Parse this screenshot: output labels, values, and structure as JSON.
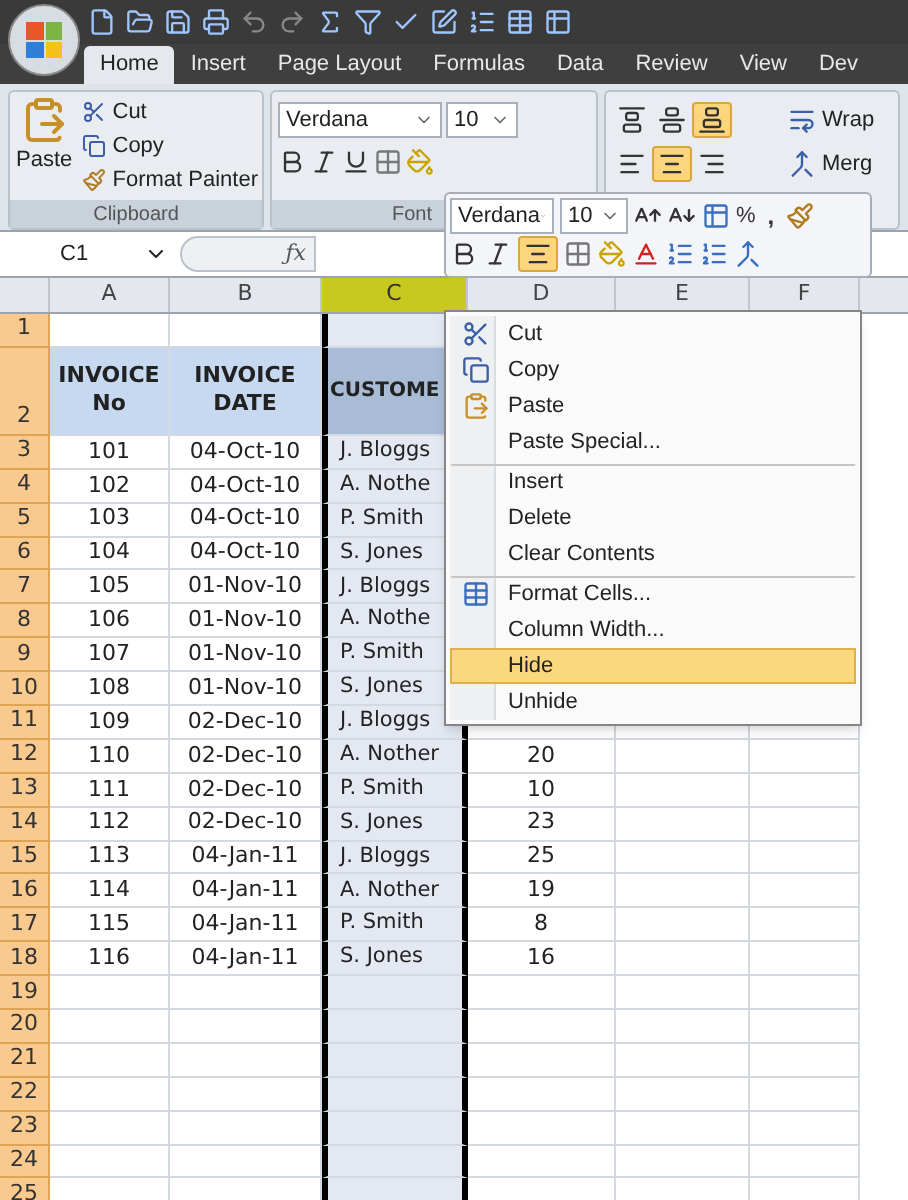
{
  "ribbon": {
    "tabs": [
      {
        "label": "Home",
        "selected": true
      },
      {
        "label": "Insert",
        "selected": false
      },
      {
        "label": "Page Layout",
        "selected": false
      },
      {
        "label": "Formulas",
        "selected": false
      },
      {
        "label": "Data",
        "selected": false
      },
      {
        "label": "Review",
        "selected": false
      },
      {
        "label": "View",
        "selected": false
      },
      {
        "label": "Dev",
        "selected": false
      }
    ],
    "clipboard": {
      "paste": "Paste",
      "cut": "Cut",
      "copy": "Copy",
      "format_painter": "Format Painter",
      "label": "Clipboard"
    },
    "font": {
      "name": "Verdana",
      "size": "10",
      "label": "Font"
    },
    "alignment": {
      "vertical": [
        {
          "selected": false
        },
        {
          "selected": false
        },
        {
          "selected": true
        }
      ],
      "horizontal": [
        {
          "selected": false
        },
        {
          "selected": true
        },
        {
          "selected": false
        }
      ],
      "wrap": "Wrap",
      "merge": "Merg"
    }
  },
  "formula_bar": {
    "name_box": "C1",
    "function_label": "ƒx"
  },
  "sheet": {
    "columns": [
      {
        "label": "A",
        "selected": false
      },
      {
        "label": "B",
        "selected": false
      },
      {
        "label": "C",
        "selected": true
      },
      {
        "label": "D",
        "selected": false
      },
      {
        "label": "E",
        "selected": false
      },
      {
        "label": "F",
        "selected": false
      }
    ],
    "header_row": {
      "number": "2",
      "invoice_no": "INVOICE No",
      "invoice_date": "INVOICE DATE",
      "customer": "CUSTOME"
    },
    "rows": [
      {
        "number": "1"
      },
      {
        "number": "3",
        "invoice_no": "101",
        "invoice_date": "04-Oct-10",
        "customer": "J. Bloggs"
      },
      {
        "number": "4",
        "invoice_no": "102",
        "invoice_date": "04-Oct-10",
        "customer": "A. Nothe"
      },
      {
        "number": "5",
        "invoice_no": "103",
        "invoice_date": "04-Oct-10",
        "customer": "P. Smith"
      },
      {
        "number": "6",
        "invoice_no": "104",
        "invoice_date": "04-Oct-10",
        "customer": "S. Jones"
      },
      {
        "number": "7",
        "invoice_no": "105",
        "invoice_date": "01-Nov-10",
        "customer": "J. Bloggs"
      },
      {
        "number": "8",
        "invoice_no": "106",
        "invoice_date": "01-Nov-10",
        "customer": "A. Nothe"
      },
      {
        "number": "9",
        "invoice_no": "107",
        "invoice_date": "01-Nov-10",
        "customer": "P. Smith"
      },
      {
        "number": "10",
        "invoice_no": "108",
        "invoice_date": "01-Nov-10",
        "customer": "S. Jones"
      },
      {
        "number": "11",
        "invoice_no": "109",
        "invoice_date": "02-Dec-10",
        "customer": "J. Bloggs"
      },
      {
        "number": "12",
        "invoice_no": "110",
        "invoice_date": "02-Dec-10",
        "customer": "A. Nother",
        "column_d": "20"
      },
      {
        "number": "13",
        "invoice_no": "111",
        "invoice_date": "02-Dec-10",
        "customer": "P. Smith",
        "column_d": "10"
      },
      {
        "number": "14",
        "invoice_no": "112",
        "invoice_date": "02-Dec-10",
        "customer": "S. Jones",
        "column_d": "23"
      },
      {
        "number": "15",
        "invoice_no": "113",
        "invoice_date": "04-Jan-11",
        "customer": "J. Bloggs",
        "column_d": "25"
      },
      {
        "number": "16",
        "invoice_no": "114",
        "invoice_date": "04-Jan-11",
        "customer": "A. Nother",
        "column_d": "19"
      },
      {
        "number": "17",
        "invoice_no": "115",
        "invoice_date": "04-Jan-11",
        "customer": "P. Smith",
        "column_d": "8"
      },
      {
        "number": "18",
        "invoice_no": "116",
        "invoice_date": "04-Jan-11",
        "customer": "S. Jones",
        "column_d": "16"
      },
      {
        "number": "19"
      },
      {
        "number": "20"
      },
      {
        "number": "21"
      },
      {
        "number": "22"
      },
      {
        "number": "23"
      },
      {
        "number": "24"
      },
      {
        "number": "25"
      }
    ]
  },
  "mini_toolbar": {
    "font": "Verdana",
    "size": "10",
    "percent": "%",
    "comma": ",",
    "alignment_selected": true
  },
  "context_menu": {
    "items": [
      {
        "label": "Cut",
        "selected": false,
        "separator_before": false
      },
      {
        "label": "Copy",
        "selected": false,
        "separator_before": false
      },
      {
        "label": "Paste",
        "selected": false,
        "separator_before": false
      },
      {
        "label": "Paste Special...",
        "selected": false,
        "separator_before": false
      },
      {
        "label": "Insert",
        "selected": false,
        "separator_before": true
      },
      {
        "label": "Delete",
        "selected": false,
        "separator_before": false
      },
      {
        "label": "Clear Contents",
        "selected": false,
        "separator_before": false
      },
      {
        "label": "Format Cells...",
        "selected": false,
        "separator_before": true
      },
      {
        "label": "Column Width...",
        "selected": false,
        "separator_before": false
      },
      {
        "label": "Hide",
        "selected": true,
        "separator_before": false
      },
      {
        "label": "Unhide",
        "selected": false,
        "separator_before": false
      }
    ]
  }
}
